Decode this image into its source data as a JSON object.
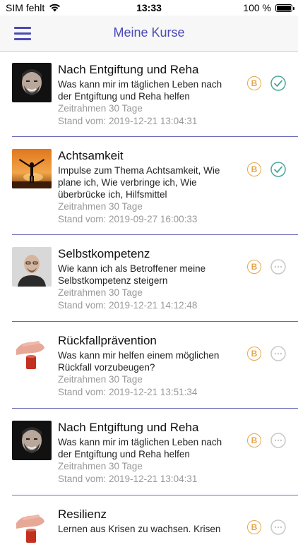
{
  "status_bar": {
    "carrier": "SIM fehlt",
    "time": "13:33",
    "battery": "100 %"
  },
  "nav": {
    "title": "Meine Kurse",
    "menu_icon": "hamburger-icon"
  },
  "colors": {
    "accent": "#4a4ab8",
    "badge": "#e6a64a",
    "done": "#4aa89a",
    "pending": "#c8c8c8"
  },
  "courses": [
    {
      "image": "man-portrait",
      "title": "Nach Entgiftung und Reha",
      "desc": "Was kann mir im täglichen Leben nach der Entgiftung und Reha helfen",
      "duration": "Zeitrahmen 30 Tage",
      "date": "Stand vom: 2019-12-21 13:04:31",
      "badge": "B",
      "status": "done"
    },
    {
      "image": "sunset-silhouette",
      "title": "Achtsamkeit",
      "desc": "Impulse zum Thema Achtsamkeit, Wie plane ich, Wie verbringe ich, Wie überbrücke ich, Hilfsmittel",
      "duration": "Zeitrahmen 30 Tage",
      "date": "Stand vom: 2019-09-27 16:00:33",
      "badge": "B",
      "status": "done"
    },
    {
      "image": "bald-man-portrait",
      "title": "Selbstkompetenz",
      "desc": "Wie kann ich als Betroffener meine Selbstkompetenz steigern",
      "duration": "Zeitrahmen 30 Tage",
      "date": "Stand vom: 2019-12-21 14:12:48",
      "badge": "B",
      "status": "pending"
    },
    {
      "image": "hand-refusing-glass",
      "title": "Rückfallprävention",
      "desc": "Was kann mir helfen einem möglichen Rückfall vorzubeugen?",
      "duration": "Zeitrahmen 30 Tage",
      "date": "Stand vom: 2019-12-21 13:51:34",
      "badge": "B",
      "status": "pending"
    },
    {
      "image": "man-portrait",
      "title": "Nach Entgiftung und Reha",
      "desc": "Was kann mir im täglichen Leben nach der Entgiftung und Reha helfen",
      "duration": "Zeitrahmen 30 Tage",
      "date": "Stand vom: 2019-12-21 13:04:31",
      "badge": "B",
      "status": "pending"
    },
    {
      "image": "hand-refusing-glass",
      "title": "Resilienz",
      "desc": " Lernen aus Krisen zu wachsen. Krisen",
      "duration": "",
      "date": "",
      "badge": "B",
      "status": "pending"
    }
  ]
}
